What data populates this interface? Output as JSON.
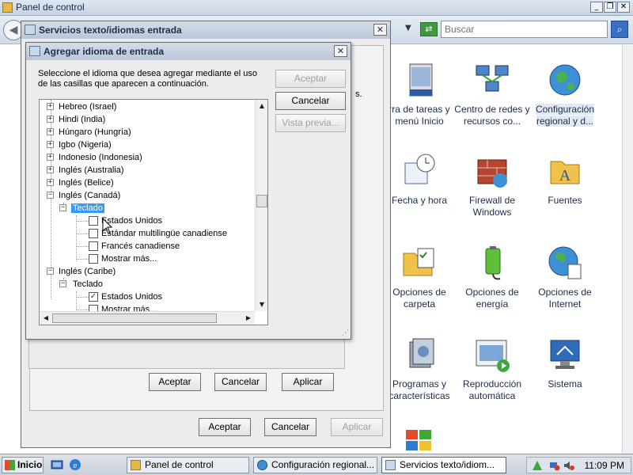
{
  "control_panel": {
    "title": "Panel de control",
    "search_placeholder": "Buscar",
    "items": [
      {
        "label": "rra de tareas y menú Inicio",
        "icon": "taskbar-icon"
      },
      {
        "label": "Centro de redes y recursos co...",
        "icon": "network-center-icon"
      },
      {
        "label": "Configuración regional y d...",
        "icon": "regional-settings-icon",
        "selected": true
      },
      {
        "label": "Fecha y hora",
        "icon": "clock-icon"
      },
      {
        "label": "Firewall de Windows",
        "icon": "firewall-icon"
      },
      {
        "label": "Fuentes",
        "icon": "fonts-folder-icon"
      },
      {
        "label": "Opciones de carpeta",
        "icon": "folder-options-icon"
      },
      {
        "label": "Opciones de energía",
        "icon": "power-options-icon"
      },
      {
        "label": "Opciones de Internet",
        "icon": "internet-options-icon"
      },
      {
        "label": "Programas y características",
        "icon": "programs-icon"
      },
      {
        "label": "Reproducción automática",
        "icon": "autoplay-icon"
      },
      {
        "label": "Sistema",
        "icon": "system-icon"
      }
    ]
  },
  "services_dialog": {
    "title": "Servicios texto/idiomas entrada",
    "partial_text": "s.",
    "buttons": {
      "accept": "Aceptar",
      "cancel": "Cancelar",
      "apply": "Aplicar"
    }
  },
  "regional_dialog_buttons": {
    "accept": "Aceptar",
    "cancel": "Cancelar",
    "apply": "Aplicar"
  },
  "add_language_dialog": {
    "title": "Agregar idioma de entrada",
    "instruction": "Seleccione el idioma que desea agregar mediante el uso de las casillas que aparecen a continuación.",
    "buttons": {
      "accept": "Aceptar",
      "cancel": "Cancelar",
      "preview": "Vista previa..."
    },
    "tree": {
      "top_nodes": [
        "Hebreo (Israel)",
        "Hindi (India)",
        "Húngaro (Hungría)",
        "Igbo (Nigeria)",
        "Indonesio (Indonesia)",
        "Inglés (Australia)",
        "Inglés (Belice)"
      ],
      "canada": {
        "label": "Inglés (Canadá)",
        "keyboard_label": "Teclado",
        "options": [
          {
            "label": "Estados Unidos",
            "checked": false
          },
          {
            "label": "Estándar multilingüe canadiense",
            "checked": false
          },
          {
            "label": "Francés canadiense",
            "checked": false
          },
          {
            "label": "Mostrar más...",
            "checked": false
          }
        ]
      },
      "caribbean": {
        "label": "Inglés (Caribe)",
        "keyboard_label": "Teclado",
        "options": [
          {
            "label": "Estados Unidos",
            "checked": true
          },
          {
            "label": "Mostrar más...",
            "checked": false
          }
        ]
      }
    }
  },
  "taskbar": {
    "start_label": "Inicio",
    "tasks": [
      "Panel de control",
      "Configuración regional...",
      "Servicios texto/idiom..."
    ],
    "clock": "11:09 PM"
  }
}
